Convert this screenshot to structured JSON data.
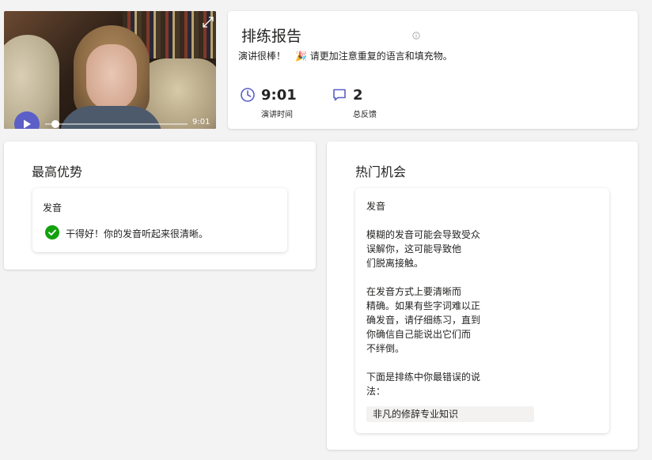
{
  "video": {
    "duration": "9:01",
    "progress": 0.07,
    "icons": {
      "play": "play-icon",
      "expand": "expand-icon"
    }
  },
  "report": {
    "title": "排练报告",
    "summary_praise": "演讲很棒！",
    "summary_emoji": "🎉",
    "summary_tip": "请更加注意重复的语言和填充物。",
    "metrics": [
      {
        "value": "9:01",
        "label": "演讲时间",
        "icon": "clock-icon"
      },
      {
        "value": "2",
        "label": "总反馈",
        "icon": "comment-icon"
      }
    ]
  },
  "strengths": {
    "title": "最高优势",
    "card": {
      "heading": "发音",
      "message": "干得好！你的发音听起来很清晰。"
    }
  },
  "opportunities": {
    "title": "热门机会",
    "card": {
      "heading": "发音",
      "paragraph1_lines": [
        "模糊的发音可能会导致受众",
        "误解你，这可能导致他",
        "们脱离接触。"
      ],
      "paragraph2_lines": [
        "在发音方式上要清晰而",
        "精确。如果有些字词难以正",
        "确发音，请仔细练习，直到",
        "你确信自己能说出它们而",
        "不绊倒。"
      ],
      "paragraph3_lines": [
        "下面是排练中你最错误的说",
        "法："
      ],
      "phrase": "非凡的修辞专业知识"
    }
  },
  "colors": {
    "accent": "#5b5fc7",
    "success": "#13a10e",
    "background": "#f3f3f4"
  }
}
